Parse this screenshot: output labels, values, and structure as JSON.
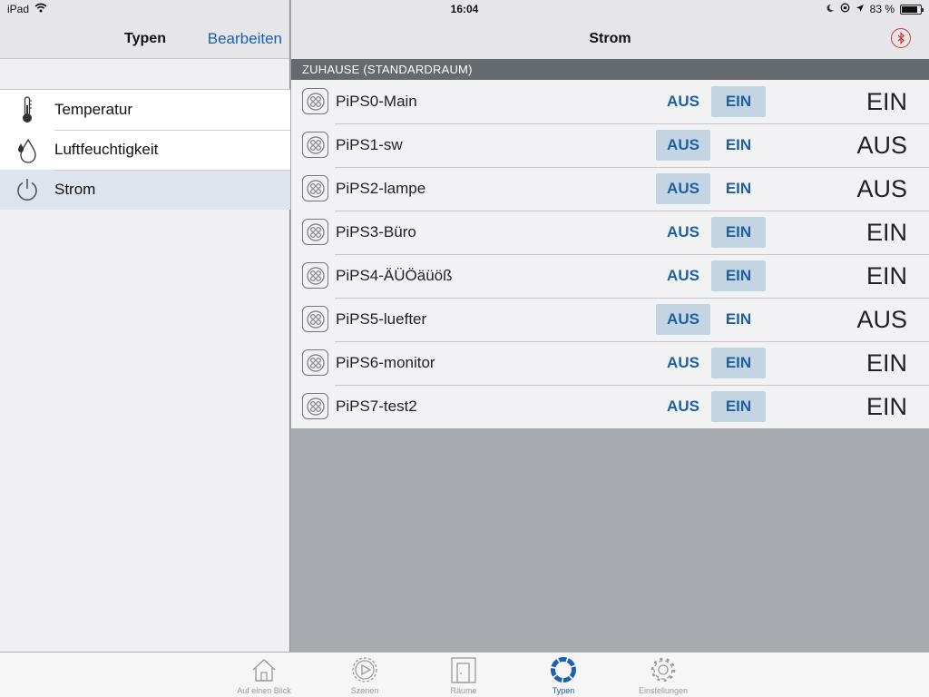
{
  "status_bar": {
    "device": "iPad",
    "time": "16:04",
    "battery": "83 %",
    "battery_level": 0.83,
    "icons": [
      "wifi-icon",
      "moon-icon",
      "rotation-lock-icon",
      "location-arrow-icon",
      "battery-icon"
    ]
  },
  "sidebar": {
    "title": "Typen",
    "edit_label": "Bearbeiten",
    "items": [
      {
        "label": "Temperatur",
        "icon": "thermometer-icon",
        "selected": false
      },
      {
        "label": "Luftfeuchtigkeit",
        "icon": "droplet-icon",
        "selected": false
      },
      {
        "label": "Strom",
        "icon": "power-icon",
        "selected": true
      }
    ]
  },
  "main": {
    "title": "Strom",
    "header_icon": "bluetooth-icon",
    "section": "ZUHAUSE (STANDARDRAUM)",
    "off_label": "AUS",
    "on_label": "EIN",
    "devices": [
      {
        "name": "PiPS0-Main",
        "state": "EIN"
      },
      {
        "name": "PiPS1-sw",
        "state": "AUS"
      },
      {
        "name": "PiPS2-lampe",
        "state": "AUS"
      },
      {
        "name": "PiPS3-Büro",
        "state": "EIN"
      },
      {
        "name": "PiPS4-ÄÜÖäüöß",
        "state": "EIN"
      },
      {
        "name": "PiPS5-luefter",
        "state": "AUS"
      },
      {
        "name": "PiPS6-monitor",
        "state": "EIN"
      },
      {
        "name": "PiPS7-test2",
        "state": "EIN"
      }
    ]
  },
  "tabbar": {
    "tabs": [
      {
        "label": "Auf einen Blick",
        "icon": "house-icon",
        "active": false
      },
      {
        "label": "Szenen",
        "icon": "play-icon",
        "active": false
      },
      {
        "label": "Räume",
        "icon": "door-icon",
        "active": false
      },
      {
        "label": "Typen",
        "icon": "types-ring-icon",
        "active": true
      },
      {
        "label": "Einstellungen",
        "icon": "gear-icon",
        "active": false
      }
    ]
  },
  "colors": {
    "accent": "#1b5fae",
    "section_header": "#656a6f",
    "button_active": "#c3d4e3",
    "bluetooth": "#d0333b"
  }
}
